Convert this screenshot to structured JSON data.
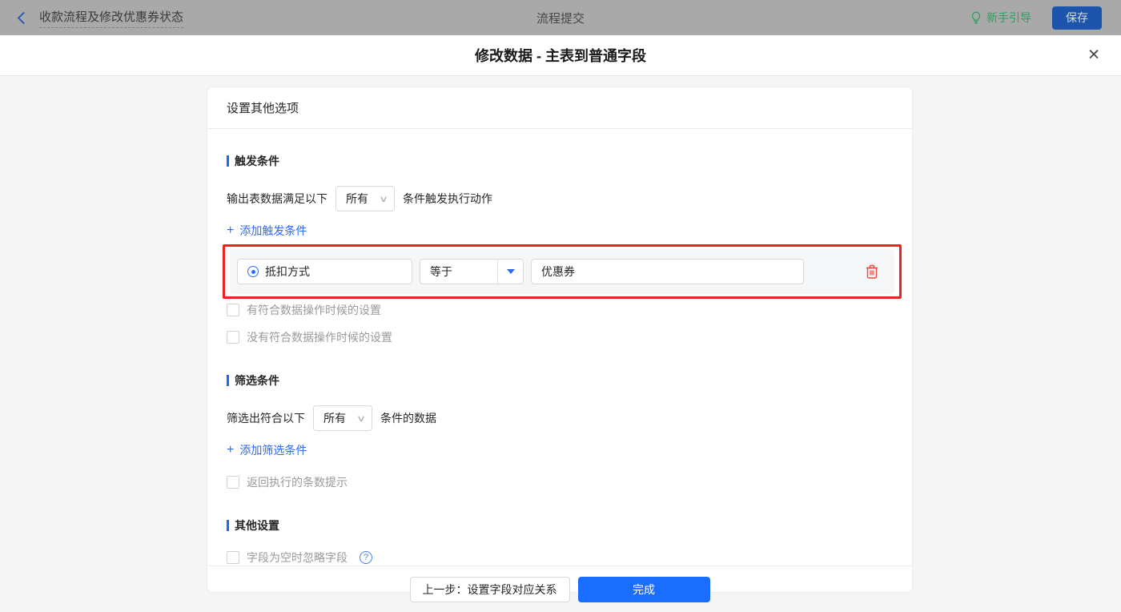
{
  "colors": {
    "accent_blue": "#1a6eff",
    "link_blue": "#2e6bf2",
    "guide_green": "#2f9e5f",
    "annotation_red": "#ee2121",
    "trash_red": "#f0483e",
    "topbar_dimmed": "#a9a9a9"
  },
  "topbar": {
    "back_title": "收款流程及修改优惠券状态",
    "center_title": "流程提交",
    "guide_label": "新手引导",
    "save_label": "保存"
  },
  "modal": {
    "title": "修改数据 - 主表到普通字段",
    "card_title": "设置其他选项",
    "trigger": {
      "section_title": "触发条件",
      "prefix": "输出表数据满足以下",
      "match_select_value": "所有",
      "suffix": "条件触发执行动作",
      "add_link_label": "添加触发条件",
      "condition": {
        "field": "抵扣方式",
        "operator": "等于",
        "value": "优惠券"
      },
      "checkbox_has_match": "有符合数据操作时候的设置",
      "checkbox_no_match": "没有符合数据操作时候的设置"
    },
    "filter": {
      "section_title": "筛选条件",
      "prefix": "筛选出符合以下",
      "match_select_value": "所有",
      "suffix": "条件的数据",
      "add_link_label": "添加筛选条件",
      "checkbox_count_tip": "返回执行的条数提示"
    },
    "other": {
      "section_title": "其他设置",
      "checkbox_ignore_empty": "字段为空时忽略字段"
    },
    "footer": {
      "prev_label": "上一步：设置字段对应关系",
      "done_label": "完成"
    }
  },
  "icons": {
    "close": "✕",
    "plus": "+",
    "caret_down": "∨",
    "help": "?"
  }
}
